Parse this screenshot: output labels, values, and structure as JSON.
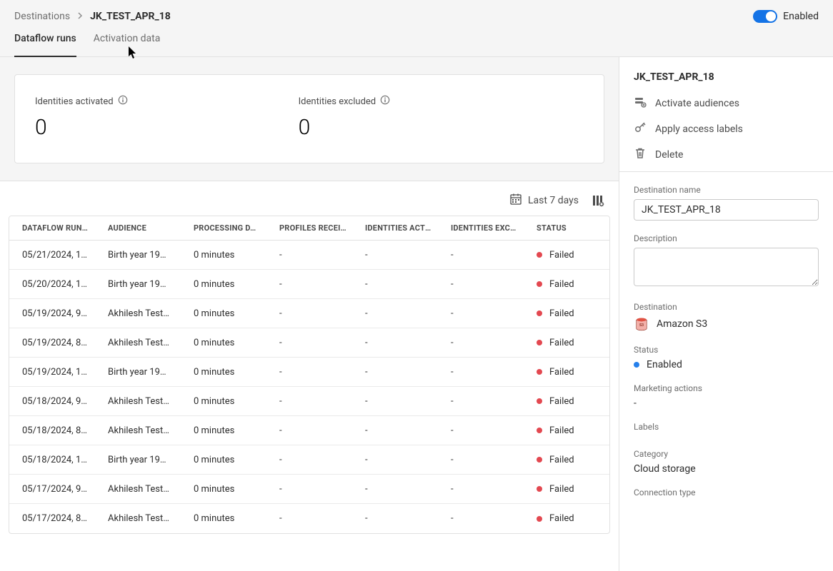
{
  "breadcrumb": {
    "root": "Destinations",
    "current": "JK_TEST_APR_18"
  },
  "toggle": {
    "label": "Enabled"
  },
  "tabs": {
    "dataflow_runs": "Dataflow runs",
    "activation_data": "Activation data"
  },
  "stats": {
    "identities_activated_label": "Identities activated",
    "identities_activated_value": "0",
    "identities_excluded_label": "Identities excluded",
    "identities_excluded_value": "0"
  },
  "toolbar": {
    "date_range": "Last 7 days"
  },
  "table": {
    "headers": {
      "dataflow_run": "DATAFLOW RUN…",
      "audience": "AUDIENCE",
      "processing": "PROCESSING D…",
      "profiles": "PROFILES RECEI…",
      "identities_act": "IDENTITIES ACTI…",
      "identities_exc": "IDENTITIES EXC…",
      "status": "STATUS"
    },
    "rows": [
      {
        "start": "05/21/2024, 1…",
        "audience": "Birth year 19…",
        "processing": "0 minutes",
        "profiles": "-",
        "id_act": "-",
        "id_exc": "-",
        "status": "Failed"
      },
      {
        "start": "05/20/2024, 1…",
        "audience": "Birth year 19…",
        "processing": "0 minutes",
        "profiles": "-",
        "id_act": "-",
        "id_exc": "-",
        "status": "Failed"
      },
      {
        "start": "05/19/2024, 9…",
        "audience": "Akhilesh Test…",
        "processing": "0 minutes",
        "profiles": "-",
        "id_act": "-",
        "id_exc": "-",
        "status": "Failed"
      },
      {
        "start": "05/19/2024, 8…",
        "audience": "Akhilesh Test…",
        "processing": "0 minutes",
        "profiles": "-",
        "id_act": "-",
        "id_exc": "-",
        "status": "Failed"
      },
      {
        "start": "05/19/2024, 1…",
        "audience": "Birth year 19…",
        "processing": "0 minutes",
        "profiles": "-",
        "id_act": "-",
        "id_exc": "-",
        "status": "Failed"
      },
      {
        "start": "05/18/2024, 9…",
        "audience": "Akhilesh Test…",
        "processing": "0 minutes",
        "profiles": "-",
        "id_act": "-",
        "id_exc": "-",
        "status": "Failed"
      },
      {
        "start": "05/18/2024, 8…",
        "audience": "Akhilesh Test…",
        "processing": "0 minutes",
        "profiles": "-",
        "id_act": "-",
        "id_exc": "-",
        "status": "Failed"
      },
      {
        "start": "05/18/2024, 1…",
        "audience": "Birth year 19…",
        "processing": "0 minutes",
        "profiles": "-",
        "id_act": "-",
        "id_exc": "-",
        "status": "Failed"
      },
      {
        "start": "05/17/2024, 9…",
        "audience": "Akhilesh Test…",
        "processing": "0 minutes",
        "profiles": "-",
        "id_act": "-",
        "id_exc": "-",
        "status": "Failed"
      },
      {
        "start": "05/17/2024, 8…",
        "audience": "Akhilesh Test…",
        "processing": "0 minutes",
        "profiles": "-",
        "id_act": "-",
        "id_exc": "-",
        "status": "Failed"
      }
    ]
  },
  "panel": {
    "title": "JK_TEST_APR_18",
    "actions": {
      "activate": "Activate audiences",
      "apply_labels": "Apply access labels",
      "delete": "Delete"
    },
    "destination_name_label": "Destination name",
    "destination_name_value": "JK_TEST_APR_18",
    "description_label": "Description",
    "description_value": "",
    "destination_label": "Destination",
    "destination_value": "Amazon S3",
    "status_label": "Status",
    "status_value": "Enabled",
    "marketing_actions_label": "Marketing actions",
    "marketing_actions_value": "-",
    "labels_label": "Labels",
    "category_label": "Category",
    "category_value": "Cloud storage",
    "connection_type_label": "Connection type"
  }
}
